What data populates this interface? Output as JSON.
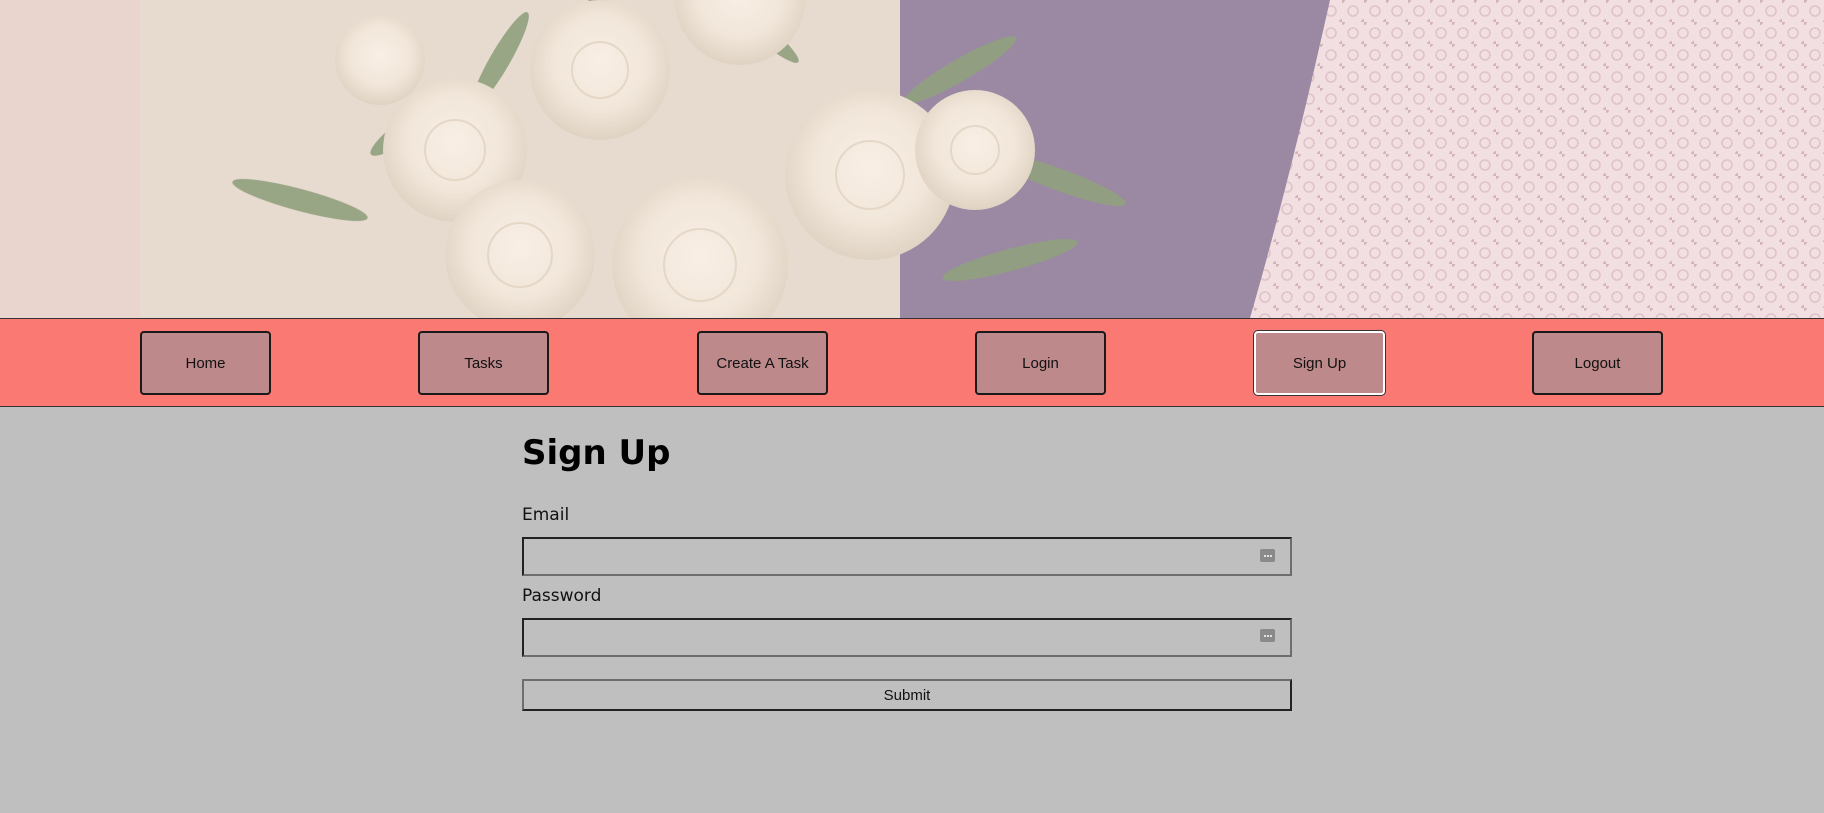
{
  "nav": {
    "items": [
      {
        "label": "Home"
      },
      {
        "label": "Tasks"
      },
      {
        "label": "Create A Task"
      },
      {
        "label": "Login"
      },
      {
        "label": "Sign Up",
        "active": true
      },
      {
        "label": "Logout"
      }
    ]
  },
  "form": {
    "title": "Sign Up",
    "email_label": "Email",
    "email_value": "",
    "password_label": "Password",
    "password_value": "",
    "submit_label": "Submit",
    "field_icon": "password-manager-icon"
  },
  "colors": {
    "navbar": "#fa7a73",
    "nav_button": "#bd898b",
    "page_background": "#bfbfbf"
  }
}
